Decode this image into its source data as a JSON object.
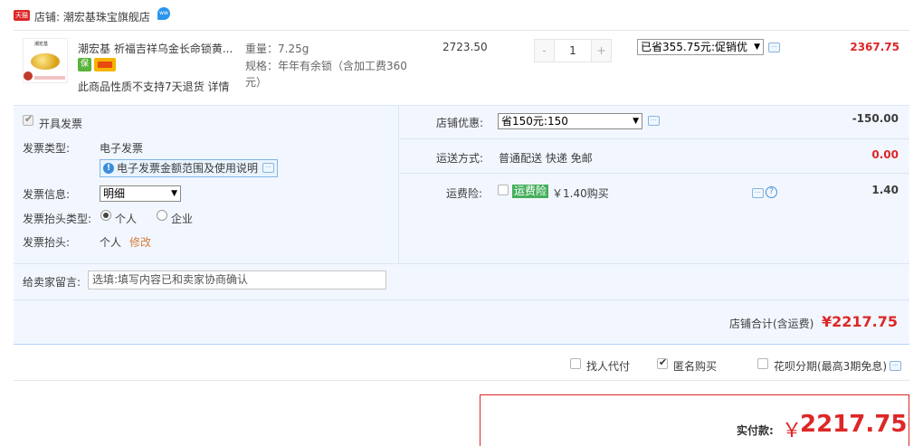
{
  "shop": {
    "badge": "天猫",
    "label": "店铺: 潮宏基珠宝旗舰店"
  },
  "product": {
    "title": "潮宏基 祈福吉祥乌金长命锁黄...",
    "weight": "重量：7.25g",
    "spec_line1": "规格：年年有余锁（含加工费360",
    "spec_line2": "元）",
    "note": "此商品性质不支持7天退货 详情",
    "price": "2723.50",
    "qty_minus": "-",
    "qty_value": "1",
    "qty_plus": "+",
    "promo_selected": "已省355.75元:促销优",
    "subtotal": "2367.75"
  },
  "invoice": {
    "open_label": "开具发票",
    "type_label": "发票类型:",
    "type_value": "电子发票",
    "tip": "电子发票金额范围及使用说明",
    "info_label": "发票信息:",
    "info_selected": "明细",
    "header_type_label": "发票抬头类型:",
    "header_type_personal": "个人",
    "header_type_company": "企业",
    "header_label": "发票抬头:",
    "header_value": "个人",
    "header_edit": "修改"
  },
  "shop_discount": {
    "label": "店铺优惠:",
    "selected": "省150元:150",
    "value": "-150.00"
  },
  "shipping": {
    "label": "运送方式:",
    "method": "普通配送 快递 免邮",
    "value": "0.00"
  },
  "insurance": {
    "label": "运费险:",
    "tag": "运费险",
    "desc": "￥1.40购买",
    "value": "1.40"
  },
  "message": {
    "label": "给卖家留言:",
    "placeholder": "选填:填写内容已和卖家协商确认"
  },
  "shop_total": {
    "label": "店铺合计(含运费)",
    "value": "¥2217.75"
  },
  "options": {
    "proxy_pay": "找人代付",
    "anonymous": "匿名购买",
    "huabei": "花呗分期(最高3期免息)"
  },
  "payment": {
    "label": "实付款:",
    "yen": "￥",
    "value": "2217.75"
  },
  "colors": {
    "accent_red": "#dd2727",
    "panel_blue": "#f2f7ff",
    "link_orange": "#d67b3a",
    "insurance_green": "#45b05c"
  }
}
